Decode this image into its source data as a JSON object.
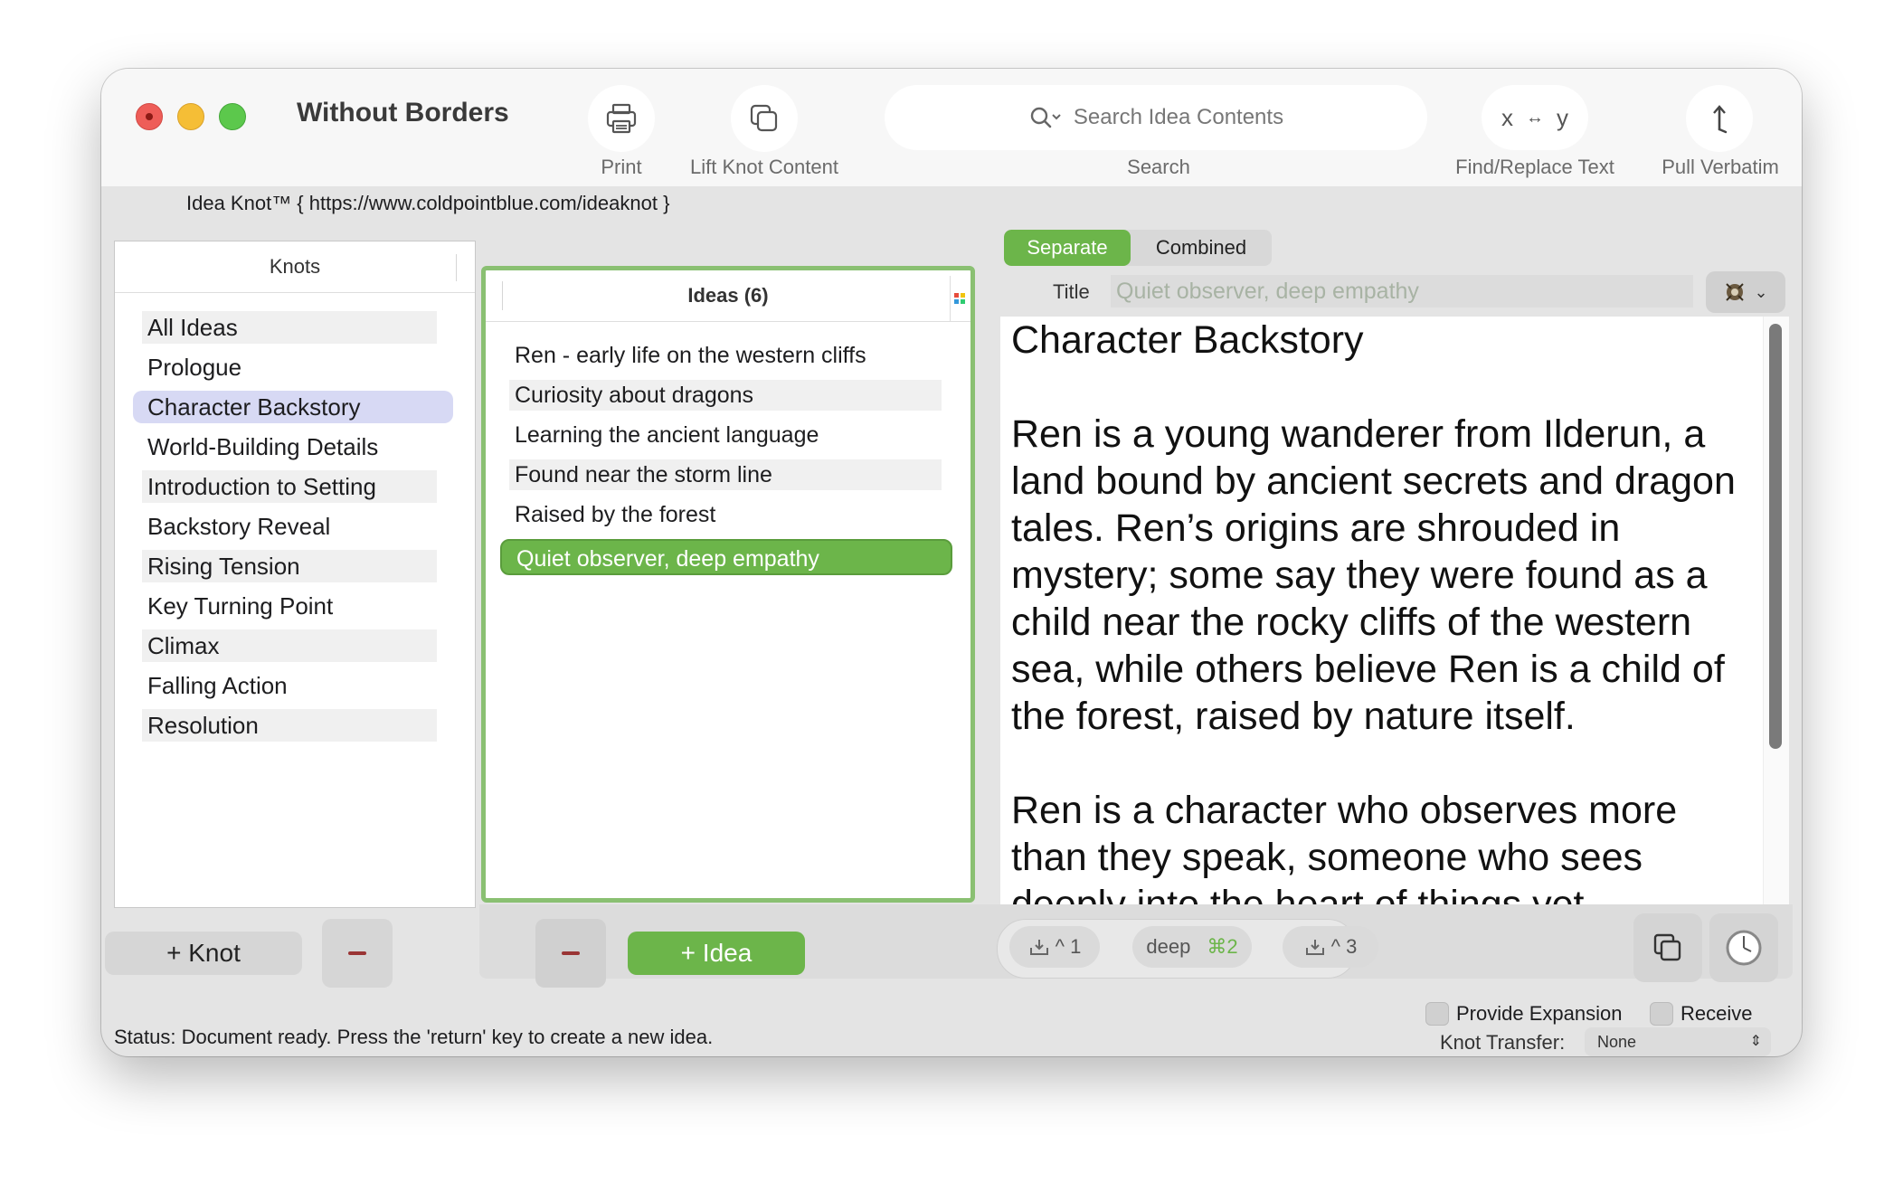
{
  "window": {
    "title": "Without Borders",
    "app_info": "Idea Knot™ { https://www.coldpointblue.com/ideaknot }"
  },
  "toolbar": {
    "print_label": "Print",
    "lift_label": "Lift Knot Content",
    "search_placeholder": "Search Idea Contents",
    "search_label": "Search",
    "findreplace_glyph_x": "x",
    "findreplace_glyph_arrow": "↔",
    "findreplace_glyph_y": "y",
    "findreplace_label": "Find/Replace Text",
    "pull_label": "Pull Verbatim"
  },
  "knots": {
    "header": "Knots",
    "items": [
      {
        "label": "All Ideas"
      },
      {
        "label": "Prologue"
      },
      {
        "label": "Character Backstory"
      },
      {
        "label": "World-Building Details"
      },
      {
        "label": "Introduction to Setting"
      },
      {
        "label": "Backstory Reveal"
      },
      {
        "label": "Rising Tension"
      },
      {
        "label": "Key Turning Point"
      },
      {
        "label": "Climax"
      },
      {
        "label": "Falling Action"
      },
      {
        "label": "Resolution"
      }
    ],
    "selected_index": 2,
    "add_label": "+ Knot",
    "remove_label": "−"
  },
  "ideas": {
    "header": "Ideas (6)",
    "items": [
      {
        "label": "Ren - early life on the western cliffs"
      },
      {
        "label": "Curiosity about dragons"
      },
      {
        "label": "Learning the ancient language"
      },
      {
        "label": "Found near the storm line"
      },
      {
        "label": "Raised by the forest"
      },
      {
        "label": "Quiet observer, deep empathy"
      }
    ],
    "selected_index": 5,
    "add_label": "+ Idea",
    "remove_label": "−"
  },
  "editor": {
    "mode_separate": "Separate",
    "mode_combined": "Combined",
    "title_label": "Title",
    "title_value": "Quiet observer, deep empathy",
    "body": "Character Backstory\n\nRen is a young wanderer from Ilderun, a land bound by ancient secrets and dragon tales. Ren’s origins are shrouded in mystery; some say they were found as a child near the rocky cliffs of the western sea, while others believe Ren is a child of the forest, raised by nature itself.\n\nRen is a character who observes more than they speak, someone who sees deeply into the heart of things yet"
  },
  "shortcuts": {
    "chip1": "^ 1",
    "chip2_word": "deep",
    "chip2_key": "⌘2",
    "chip3": "^ 3"
  },
  "status": {
    "text": "Status: Document ready. Press the 'return' key to create a new idea."
  },
  "transfer": {
    "provide_label": "Provide Expansion",
    "receive_label": "Receive",
    "knot_transfer_label": "Knot Transfer:",
    "knot_transfer_value": "None"
  },
  "colors": {
    "accent_green": "#6cb54a",
    "selection_lavender": "#d7d9f4",
    "close": "#ee5d58",
    "minimize": "#f5be36",
    "zoom": "#5cc84c"
  }
}
